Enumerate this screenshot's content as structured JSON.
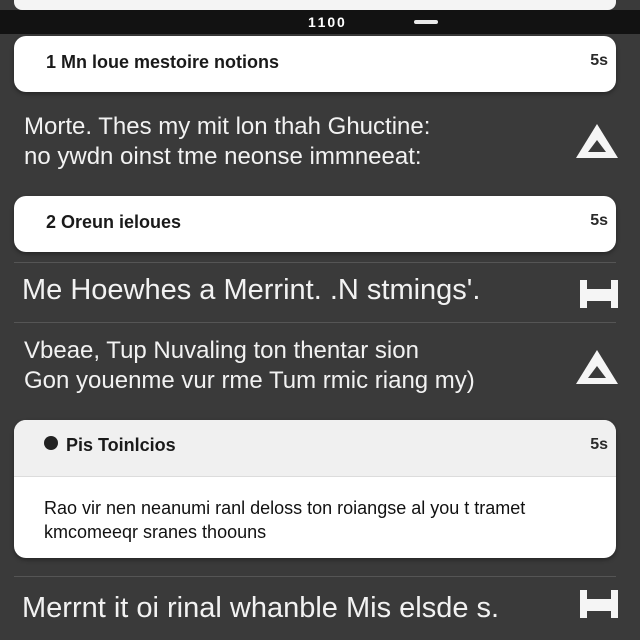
{
  "status": {
    "time": "1 1 0 0"
  },
  "groups": [
    {
      "title": "1  Mn loue mestoire notions",
      "count": "5s"
    },
    {
      "title": "2  Oreun ieloues",
      "count": "5s"
    }
  ],
  "notifications": [
    {
      "line1": "Morte. Thes my mit lon thah Ghuctine:",
      "line2": "no ywdn oinst tme neonse immneeat:"
    },
    {
      "title": "Me Hoewhes a Merrint. .N stmings'."
    },
    {
      "line1": "Vbeae, Tup Nuvaling ton thentar sion",
      "line2": "Gon youenme vur rme Tum rmic riang my)"
    }
  ],
  "card": {
    "title": "Pis Toinlcios",
    "count": "5s",
    "body_line1": "Rao vir nen neanumi ranl deloss ton roiangse al you t tramet",
    "body_line2": "kmcomeeqr sranes thoouns"
  },
  "bottom": {
    "title": "Merrnt it oi rinal whanble Mis elsde s."
  }
}
